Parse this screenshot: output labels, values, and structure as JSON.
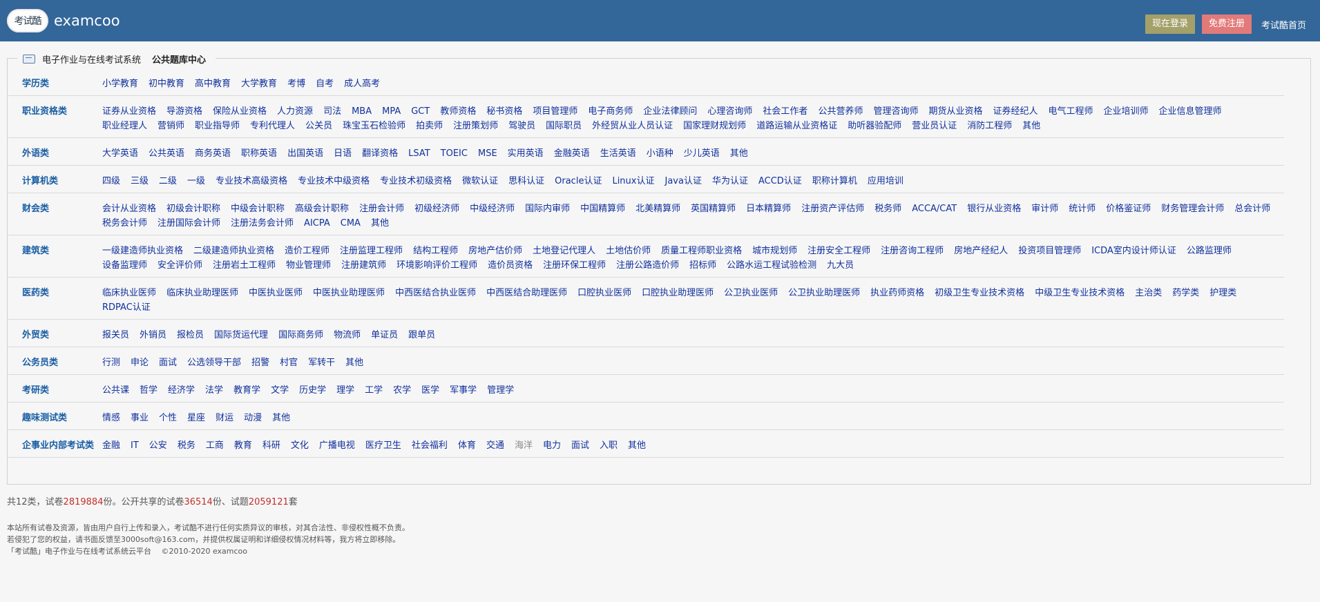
{
  "header": {
    "logo_badge": "考试酷",
    "logo_text": "examcoo",
    "login_label": "现在登录",
    "register_label": "免费注册",
    "home_label": "考试酷首页"
  },
  "legend": {
    "system": "电子作业与在线考试系统",
    "center": "公共题库中心"
  },
  "categories": [
    {
      "title": "学历类",
      "items": [
        "小学教育",
        "初中教育",
        "高中教育",
        "大学教育",
        "考博",
        "自考",
        "成人高考"
      ]
    },
    {
      "title": "职业资格类",
      "items": [
        "证券从业资格",
        "导游资格",
        "保险从业资格",
        "人力资源",
        "司法",
        "MBA",
        "MPA",
        "GCT",
        "教师资格",
        "秘书资格",
        "项目管理师",
        "电子商务师",
        "企业法律顾问",
        "心理咨询师",
        "社会工作者",
        "公共营养师",
        "管理咨询师",
        "期货从业资格",
        "证券经纪人",
        "电气工程师",
        "企业培训师",
        "企业信息管理师",
        "职业经理人",
        "营销师",
        "职业指导师",
        "专利代理人",
        "公关员",
        "珠宝玉石检验师",
        "拍卖师",
        "注册策划师",
        "驾驶员",
        "国际职员",
        "外经贸从业人员认证",
        "国家理财规划师",
        "道路运输从业资格证",
        "助听器验配师",
        "营业员认证",
        "消防工程师",
        "其他"
      ]
    },
    {
      "title": "外语类",
      "items": [
        "大学英语",
        "公共英语",
        "商务英语",
        "职称英语",
        "出国英语",
        "日语",
        "翻译资格",
        "LSAT",
        "TOEIC",
        "MSE",
        "实用英语",
        "金融英语",
        "生活英语",
        "小语种",
        "少儿英语",
        "其他"
      ]
    },
    {
      "title": "计算机类",
      "items": [
        "四级",
        "三级",
        "二级",
        "一级",
        "专业技术高级资格",
        "专业技术中级资格",
        "专业技术初级资格",
        "微软认证",
        "思科认证",
        "Oracle认证",
        "Linux认证",
        "Java认证",
        "华为认证",
        "ACCD认证",
        "职称计算机",
        "应用培训"
      ]
    },
    {
      "title": "财会类",
      "items": [
        "会计从业资格",
        "初级会计职称",
        "中级会计职称",
        "高级会计职称",
        "注册会计师",
        "初级经济师",
        "中级经济师",
        "国际内审师",
        "中国精算师",
        "北美精算师",
        "英国精算师",
        "日本精算师",
        "注册资产评估师",
        "税务师",
        "ACCA/CAT",
        "银行从业资格",
        "审计师",
        "统计师",
        "价格鉴证师",
        "财务管理会计师",
        "总会计师",
        "税务会计师",
        "注册国际会计师",
        "注册法务会计师",
        "AICPA",
        "CMA",
        "其他"
      ]
    },
    {
      "title": "建筑类",
      "items": [
        "一级建造师执业资格",
        "二级建造师执业资格",
        "造价工程师",
        "注册监理工程师",
        "结构工程师",
        "房地产估价师",
        "土地登记代理人",
        "土地估价师",
        "质量工程师职业资格",
        "城市规划师",
        "注册安全工程师",
        "注册咨询工程师",
        "房地产经纪人",
        "投资项目管理师",
        "ICDA室内设计师认证",
        "公路监理师",
        "设备监理师",
        "安全评价师",
        "注册岩土工程师",
        "物业管理师",
        "注册建筑师",
        "环境影响评价工程师",
        "造价员资格",
        "注册环保工程师",
        "注册公路造价师",
        "招标师",
        "公路水运工程试验检测",
        "九大员"
      ]
    },
    {
      "title": "医药类",
      "items": [
        "临床执业医师",
        "临床执业助理医师",
        "中医执业医师",
        "中医执业助理医师",
        "中西医结合执业医师",
        "中西医结合助理医师",
        "口腔执业医师",
        "口腔执业助理医师",
        "公卫执业医师",
        "公卫执业助理医师",
        "执业药师资格",
        "初级卫生专业技术资格",
        "中级卫生专业技术资格",
        "主治类",
        "药学类",
        "护理类",
        "RDPAC认证"
      ]
    },
    {
      "title": "外贸类",
      "items": [
        "报关员",
        "外销员",
        "报检员",
        "国际货运代理",
        "国际商务师",
        "物流师",
        "单证员",
        "跟单员"
      ]
    },
    {
      "title": "公务员类",
      "items": [
        "行测",
        "申论",
        "面试",
        "公选领导干部",
        "招警",
        "村官",
        "军转干",
        "其他"
      ]
    },
    {
      "title": "考研类",
      "items": [
        "公共课",
        "哲学",
        "经济学",
        "法学",
        "教育学",
        "文学",
        "历史学",
        "理学",
        "工学",
        "农学",
        "医学",
        "军事学",
        "管理学"
      ]
    },
    {
      "title": "趣味测试类",
      "items": [
        "情感",
        "事业",
        "个性",
        "星座",
        "财运",
        "动漫",
        "其他"
      ]
    },
    {
      "title": "企事业内部考试类",
      "items": [
        "金融",
        "IT",
        "公安",
        "税务",
        "工商",
        "教育",
        "科研",
        "文化",
        "广播电视",
        "医疗卫生",
        "社会福利",
        "体育",
        "交通",
        "海洋",
        "电力",
        "面试",
        "入职",
        "其他"
      ],
      "gray_index": 13
    }
  ],
  "stats": {
    "prefix": "共12类，试卷",
    "papers": "2819884",
    "mid1": "份。公开共享的试卷",
    "shared": "36514",
    "mid2": "份、试题",
    "questions": "2059121",
    "suffix": "套"
  },
  "footer": {
    "line1": "本站所有试卷及资源，皆由用户自行上传和录入，考试酷不进行任何实质异议的审核，对其合法性、非侵权性概不负责。",
    "line2": "若侵犯了您的权益，请书面反馈至3000soft@163.com，并提供权属证明和详细侵权情况材料等，我方将立即移除。",
    "line3": "「考试酷」电子作业与在线考试系统云平台　 ©2010-2020 examcoo"
  }
}
